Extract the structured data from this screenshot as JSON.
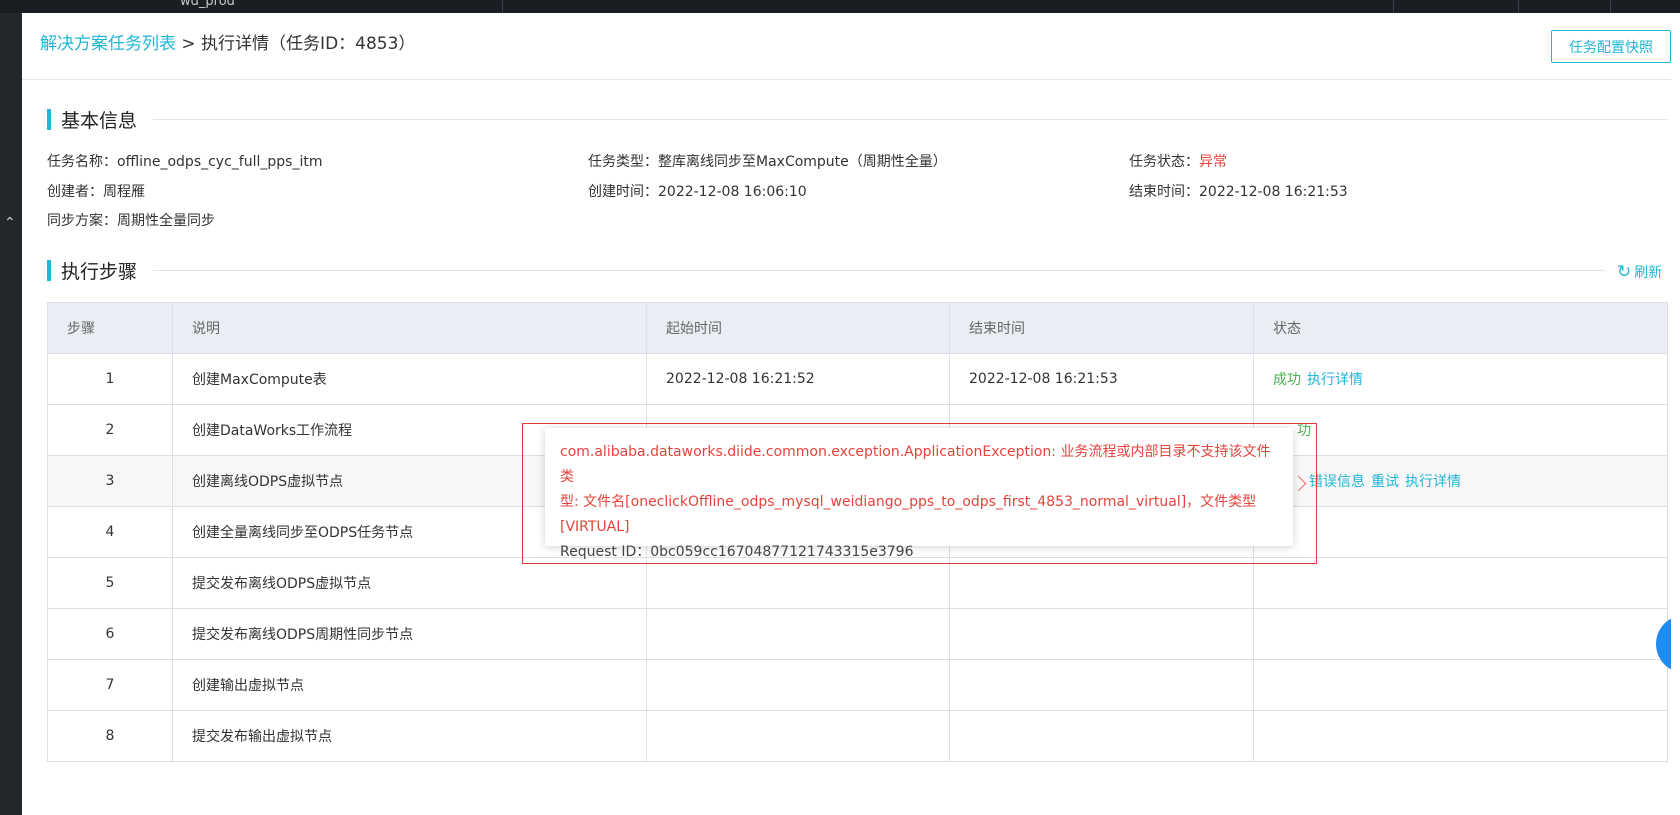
{
  "topbar": {
    "tab_cut_label": "wd_prod"
  },
  "breadcrumb": {
    "parent": "解决方案任务列表",
    "sep": ">",
    "current": "执行详情（任务ID：4853）"
  },
  "header": {
    "snapshot_button": "任务配置快照"
  },
  "basic_info": {
    "title": "基本信息",
    "task_name_label": "任务名称：",
    "task_name": "offline_odps_cyc_full_pps_itm",
    "task_type_label": "任务类型：",
    "task_type": "整库离线同步至MaxCompute（周期性全量）",
    "task_status_label": "任务状态：",
    "task_status": "异常",
    "creator_label": "创建者：",
    "creator": "周程雁",
    "create_time_label": "创建时间：",
    "create_time": "2022-12-08 16:06:10",
    "end_time_label": "结束时间：",
    "end_time": "2022-12-08 16:21:53",
    "sync_plan_label": "同步方案：",
    "sync_plan": "周期性全量同步"
  },
  "steps_section": {
    "title": "执行步骤",
    "refresh_label": "刷新",
    "columns": [
      "步骤",
      "说明",
      "起始时间",
      "结束时间",
      "状态"
    ],
    "rows": [
      {
        "step": "1",
        "desc": "创建MaxCompute表",
        "start": "2022-12-08 16:21:52",
        "end": "2022-12-08 16:21:53",
        "status": "成功",
        "actions": [
          "执行详情"
        ]
      },
      {
        "step": "2",
        "desc": "创建DataWorks工作流程",
        "start": "",
        "end": "",
        "status": "功",
        "actions": []
      },
      {
        "step": "3",
        "desc": "创建离线ODPS虚拟节点",
        "start": "",
        "end": "",
        "status": "",
        "actions": [
          "错误信息",
          "重试",
          "执行详情"
        ]
      },
      {
        "step": "4",
        "desc": "创建全量离线同步至ODPS任务节点",
        "start": "",
        "end": "",
        "status": "",
        "actions": []
      },
      {
        "step": "5",
        "desc": "提交发布离线ODPS虚拟节点",
        "start": "",
        "end": "",
        "status": "",
        "actions": []
      },
      {
        "step": "6",
        "desc": "提交发布离线ODPS周期性同步节点",
        "start": "",
        "end": "",
        "status": "",
        "actions": []
      },
      {
        "step": "7",
        "desc": "创建输出虚拟节点",
        "start": "",
        "end": "",
        "status": "",
        "actions": []
      },
      {
        "step": "8",
        "desc": "提交发布输出虚拟节点",
        "start": "",
        "end": "",
        "status": "",
        "actions": []
      }
    ]
  },
  "error_tooltip": {
    "message_line1": "com.alibaba.dataworks.diide.common.exception.ApplicationException: 业务流程或内部目录不支持该文件类",
    "message_line2": "型: 文件名[oneclickOffline_odps_mysql_weidiango_pps_to_odps_first_4853_normal_virtual]，文件类型",
    "message_line3": "[VIRTUAL]",
    "request_id": "Request ID：0bc059cc16704877121743315e3796"
  },
  "colors": {
    "accent": "#1fb6d6",
    "error": "#e5433d",
    "success": "#4caf50"
  }
}
